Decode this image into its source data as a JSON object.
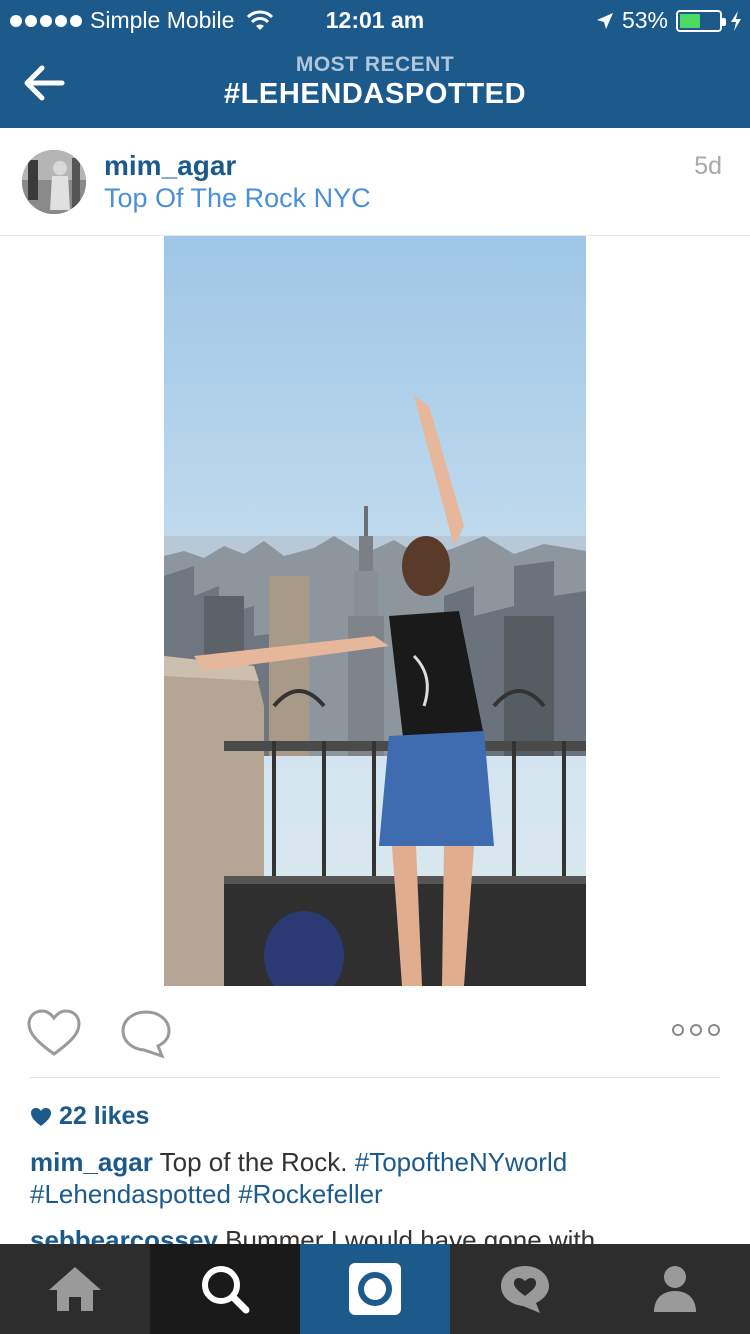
{
  "status_bar": {
    "carrier": "Simple Mobile",
    "time": "12:01 am",
    "battery_percent": "53%",
    "battery_level": 0.53,
    "signal_dots": 5
  },
  "nav": {
    "subtitle": "MOST RECENT",
    "title": "#LEHENDASPOTTED",
    "back_icon": "back-arrow-icon"
  },
  "post": {
    "username": "mim_agar",
    "location": "Top Of The Rock NYC",
    "time_ago": "5d",
    "likes": "22 likes",
    "caption_user": "mim_agar",
    "caption_text": "Top of the Rock.",
    "caption_tags": [
      "#TopoftheNYworld",
      "#Lehendaspotted",
      "#Rockefeller"
    ],
    "comment_user": "sebbearcossey",
    "comment_text": "Bummer I would have gone with"
  },
  "tabs": [
    {
      "name": "home",
      "icon": "home-icon"
    },
    {
      "name": "explore",
      "icon": "search-icon"
    },
    {
      "name": "camera",
      "icon": "camera-icon"
    },
    {
      "name": "activity",
      "icon": "activity-heart-icon"
    },
    {
      "name": "profile",
      "icon": "profile-icon"
    }
  ],
  "colors": {
    "brand_blue": "#1d5a8c",
    "link_blue": "#4a90d9",
    "battery_green": "#4cd964",
    "tab_bar": "#2d2d2d"
  }
}
